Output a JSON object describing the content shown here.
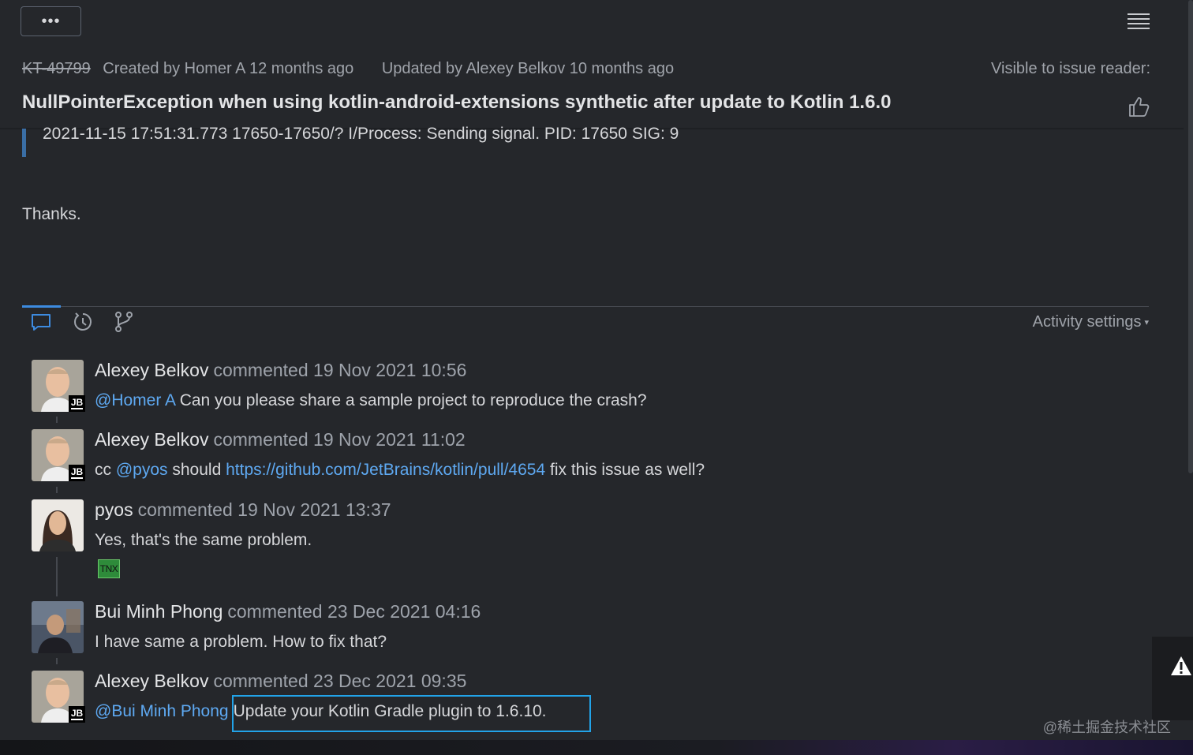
{
  "toolbar": {
    "more_label": "•••"
  },
  "issue": {
    "id": "KT-49799",
    "created": "Created by Homer A 12 months ago",
    "updated": "Updated by Alexey Belkov 10 months ago",
    "visibility": "Visible to issue reader:",
    "title": "NullPointerException when using kotlin-android-extensions synthetic after update to Kotlin 1.6.0"
  },
  "description": {
    "quote": "2021-11-15 17:51:31.773 17650-17650/? I/Process: Sending signal. PID: 17650 SIG: 9",
    "thanks": "Thanks."
  },
  "activity": {
    "settings_label": "Activity settings",
    "caret": "▾"
  },
  "comments": [
    {
      "author": "Alexey Belkov",
      "action": "commented 19 Nov 2021 10:56",
      "badge": "JB",
      "mention": "@Homer A",
      "text": " Can you please share a sample project to reproduce the crash?"
    },
    {
      "author": "Alexey Belkov",
      "action": "commented 19 Nov 2021 11:02",
      "badge": "JB",
      "prefix": "cc ",
      "mention": "@pyos",
      "middle": " should ",
      "link": "https://github.com/JetBrains/kotlin/pull/4654",
      "suffix": " fix this issue as well?"
    },
    {
      "author": "pyos",
      "action": "commented 19 Nov 2021 13:37",
      "text": "Yes, that's the same problem.",
      "reaction": "TNX"
    },
    {
      "author": "Bui Minh Phong",
      "action": "commented 23 Dec 2021 04:16",
      "text": "I have same a problem. How to fix that?"
    },
    {
      "author": "Alexey Belkov",
      "action": "commented 23 Dec 2021 09:35",
      "badge": "JB",
      "mention": "@Bui Minh Phong",
      "text": "Update your Kotlin Gradle plugin to 1.6.10."
    }
  ],
  "watermark": "@稀土掘金技术社区",
  "colors": {
    "background": "#25272b",
    "link": "#5ea9f2",
    "accent": "#3d8be0",
    "highlight": "#22a3e8"
  },
  "icons": [
    "menu-icon",
    "thumbs-up-icon",
    "comment-icon",
    "history-icon",
    "branch-icon",
    "warning-icon"
  ]
}
